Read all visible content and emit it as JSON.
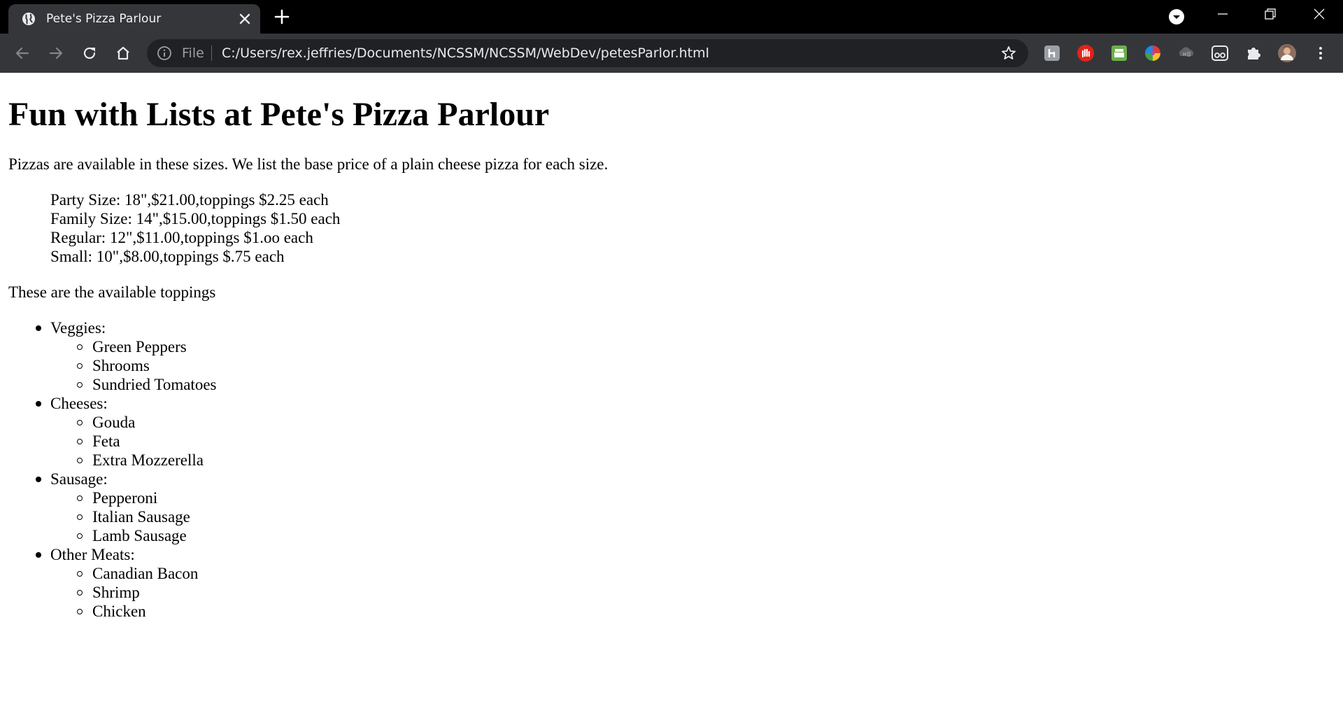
{
  "browser": {
    "tab": {
      "title": "Pete's Pizza Parlour",
      "favicon": "globe-icon"
    },
    "omnibox": {
      "scheme_label": "File",
      "url": "C:/Users/rex.jeffries/Documents/NCSSM/NCSSM/WebDev/petesParlor.html"
    },
    "extensions": [
      "extension-h-icon",
      "adblock-hand-icon",
      "printer-extension-icon",
      "color-wheel-extension-icon",
      "cloudhq-extension-icon",
      "reader-glasses-extension-icon",
      "puzzle-extensions-icon",
      "profile-avatar",
      "more-menu-icon"
    ],
    "colors": {
      "titlebar": "#000000",
      "toolbar": "#35363a",
      "omnibox": "#202124",
      "text": "#e8eaed"
    }
  },
  "page": {
    "heading": "Fun with Lists at Pete's Pizza Parlour",
    "intro": "Pizzas are available in these sizes. We list the base price of a plain cheese pizza for each size.",
    "sizes": [
      "Party Size: 18\",$21.00,toppings $2.25 each",
      "Family Size: 14\",$15.00,toppings $1.50 each",
      "Regular: 12\",$11.00,toppings $1.oo each",
      "Small: 10\",$8.00,toppings $.75 each"
    ],
    "toppings_intro": "These are the available toppings",
    "toppings": [
      {
        "category": "Veggies:",
        "items": [
          "Green Peppers",
          "Shrooms",
          "Sundried Tomatoes"
        ]
      },
      {
        "category": "Cheeses:",
        "items": [
          "Gouda",
          "Feta",
          "Extra Mozzerella"
        ]
      },
      {
        "category": "Sausage:",
        "items": [
          "Pepperoni",
          "Italian Sausage",
          "Lamb Sausage"
        ]
      },
      {
        "category": "Other Meats:",
        "items": [
          "Canadian Bacon",
          "Shrimp",
          "Chicken"
        ]
      }
    ]
  }
}
